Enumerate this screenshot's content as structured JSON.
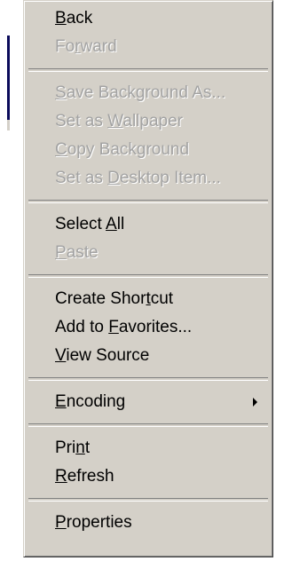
{
  "menu": {
    "groups": [
      [
        {
          "id": "back",
          "pre": "",
          "key": "B",
          "post": "ack",
          "disabled": false
        },
        {
          "id": "forward",
          "pre": "Fo",
          "key": "r",
          "post": "ward",
          "disabled": true
        }
      ],
      [
        {
          "id": "save-background-as",
          "pre": "",
          "key": "S",
          "post": "ave Background As...",
          "disabled": true
        },
        {
          "id": "set-as-wallpaper",
          "pre": "Set as ",
          "key": "W",
          "post": "allpaper",
          "disabled": true
        },
        {
          "id": "copy-background",
          "pre": "",
          "key": "C",
          "post": "opy Background",
          "disabled": true
        },
        {
          "id": "set-as-desktop-item",
          "pre": "Set as ",
          "key": "D",
          "post": "esktop Item...",
          "disabled": true
        }
      ],
      [
        {
          "id": "select-all",
          "pre": "Select ",
          "key": "A",
          "post": "ll",
          "disabled": false
        },
        {
          "id": "paste",
          "pre": "",
          "key": "P",
          "post": "aste",
          "disabled": true
        }
      ],
      [
        {
          "id": "create-shortcut",
          "pre": "Create Shor",
          "key": "t",
          "post": "cut",
          "disabled": false
        },
        {
          "id": "add-to-favorites",
          "pre": "Add to ",
          "key": "F",
          "post": "avorites...",
          "disabled": false
        },
        {
          "id": "view-source",
          "pre": "",
          "key": "V",
          "post": "iew Source",
          "disabled": false
        }
      ],
      [
        {
          "id": "encoding",
          "pre": "",
          "key": "E",
          "post": "ncoding",
          "disabled": false,
          "submenu": true
        }
      ],
      [
        {
          "id": "print",
          "pre": "Pri",
          "key": "n",
          "post": "t",
          "disabled": false
        },
        {
          "id": "refresh",
          "pre": "",
          "key": "R",
          "post": "efresh",
          "disabled": false
        }
      ],
      [
        {
          "id": "properties",
          "pre": "",
          "key": "P",
          "post": "roperties",
          "disabled": false
        }
      ]
    ]
  },
  "colors": {
    "menu_face": "#d4d0c8",
    "disabled_text": "#a3a3a3",
    "text": "#000000"
  },
  "icons": {
    "submenu": "submenu-arrow-icon"
  }
}
